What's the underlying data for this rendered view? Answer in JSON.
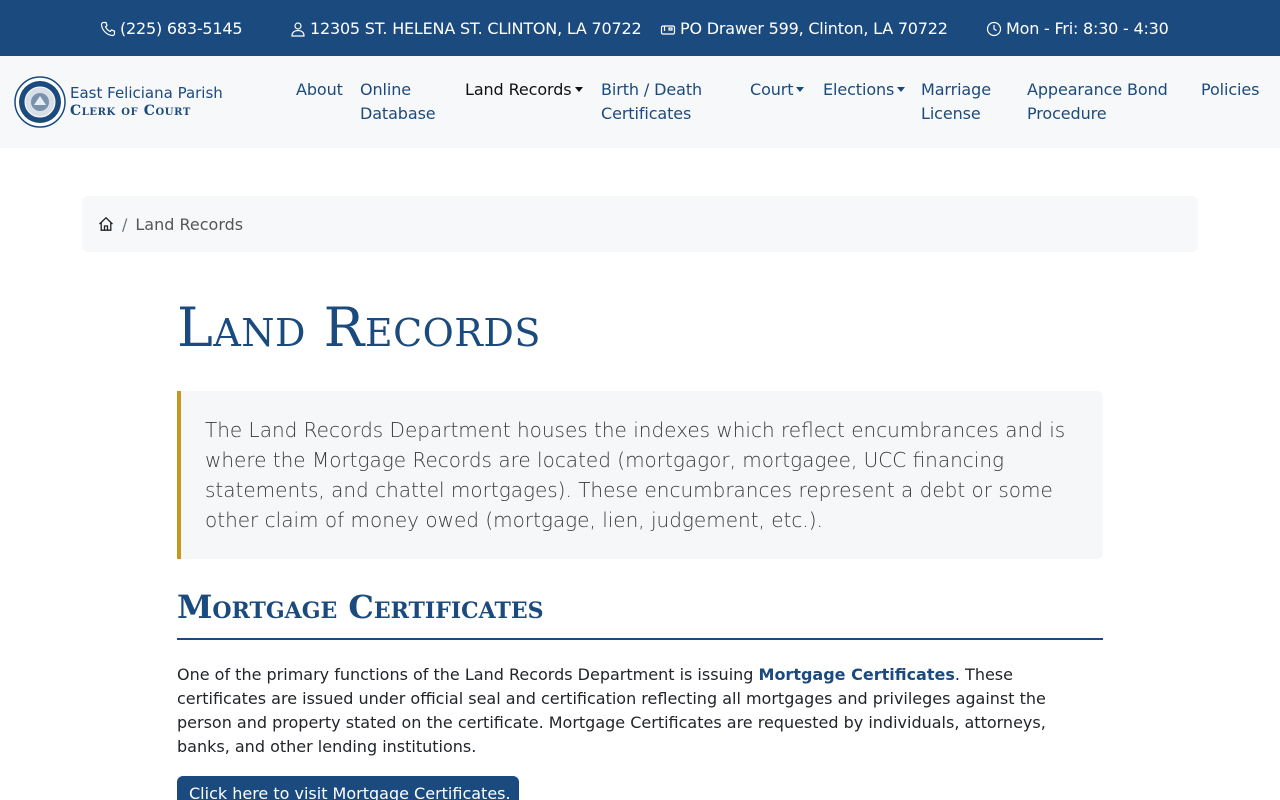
{
  "topbar": {
    "phone": "(225) 683-5145",
    "address": "12305 ST. HELENA ST. CLINTON, LA 70722",
    "mailing": "PO Drawer 599, Clinton, LA 70722",
    "hours": "Mon - Fri: 8:30 - 4:30"
  },
  "logo": {
    "line1": "East Feliciana Parish",
    "line2": "Clerk of Court"
  },
  "nav": {
    "about": "About",
    "online_db_1": "Online",
    "online_db_2": "Database",
    "land_records": "Land Records",
    "birth_death_1": "Birth / Death",
    "birth_death_2": "Certificates",
    "court": "Court",
    "elections": "Elections",
    "marriage_1": "Marriage",
    "marriage_2": "License",
    "appearance_1": "Appearance Bond",
    "appearance_2": "Procedure",
    "policies": "Policies"
  },
  "breadcrumb": {
    "separator": "/",
    "current": "Land Records"
  },
  "page": {
    "title": "Land Records",
    "callout": "The Land Records Department houses the indexes which reflect encumbrances and is where the Mortgage Records are located (mortgagor, mortgagee, UCC financing statements, and chattel mortgages). These encumbrances represent a debt or some other claim of money owed (mortgage, lien, judgement, etc.)."
  },
  "mortgage": {
    "title": "Mortgage Certificates",
    "text_before": "One of the primary functions of the Land Records Department is issuing ",
    "link": "Mortgage Certificates",
    "text_after": ". These certificates are issued under official seal and certification reflecting all mortgages and privileges against the person and property stated on the certificate. Mortgage Certificates are requested by individuals, attorneys, banks, and other lending institutions.",
    "button": "Click here to visit Mortgage Certificates."
  },
  "colors": {
    "primary": "#1b4a7e",
    "accent": "#c49a1e",
    "light_bg": "#f7f8f9"
  },
  "icons": {
    "phone": "phone-icon",
    "address": "person-pin-icon",
    "mailing": "mailbox-icon",
    "hours": "clock-icon",
    "home": "home-icon"
  }
}
